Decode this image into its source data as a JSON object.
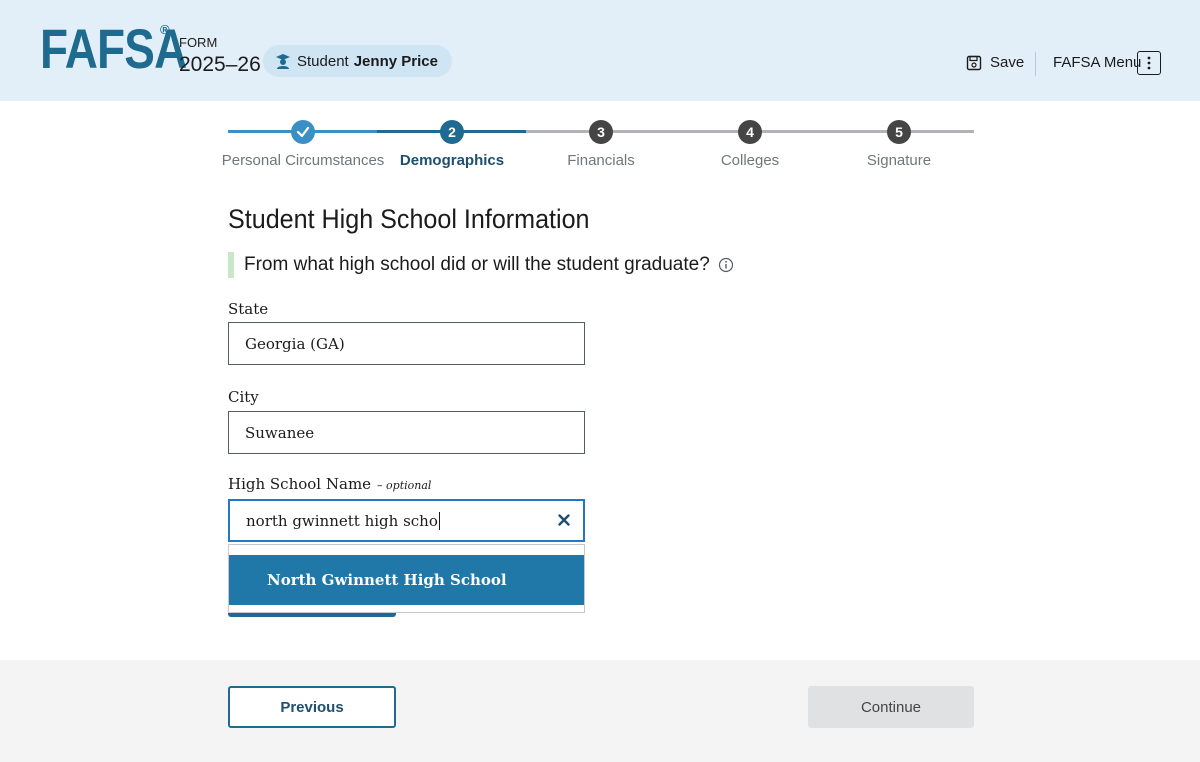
{
  "header": {
    "logo_text": "FAFSA",
    "logo_mark": "®",
    "form_label": "FORM",
    "form_year": "2025–26",
    "student_prefix": "Student",
    "student_name": "Jenny Price",
    "save_label": "Save",
    "menu_label": "FAFSA Menu",
    "icons": {
      "student": "student-icon",
      "save": "save-icon",
      "menu": "kebab-menu-icon"
    }
  },
  "steps": [
    {
      "number": "1",
      "label": "Personal Circumstances",
      "status": "complete"
    },
    {
      "number": "2",
      "label": "Demographics",
      "status": "active"
    },
    {
      "number": "3",
      "label": "Financials",
      "status": "upcoming"
    },
    {
      "number": "4",
      "label": "Colleges",
      "status": "upcoming"
    },
    {
      "number": "5",
      "label": "Signature",
      "status": "upcoming"
    }
  ],
  "main": {
    "title": "Student High School Information",
    "question": "From what high school did or will the student graduate?",
    "fields": {
      "state": {
        "label": "State",
        "value": "Georgia (GA)"
      },
      "city": {
        "label": "City",
        "value": "Suwanee"
      },
      "school": {
        "label": "High School Name",
        "optional": "– optional",
        "value": "north gwinnett high scho"
      }
    },
    "suggestions": [
      "North Gwinnett High School"
    ]
  },
  "footer": {
    "previous_label": "Previous",
    "continue_label": "Continue"
  },
  "colors": {
    "brand": "#1e6b8f",
    "header_bg": "#e3eff8",
    "step_complete": "#3b8fc7",
    "step_active": "#1e6b8f",
    "step_upcoming": "#454545",
    "suggestion_bg": "#1f78a8"
  }
}
